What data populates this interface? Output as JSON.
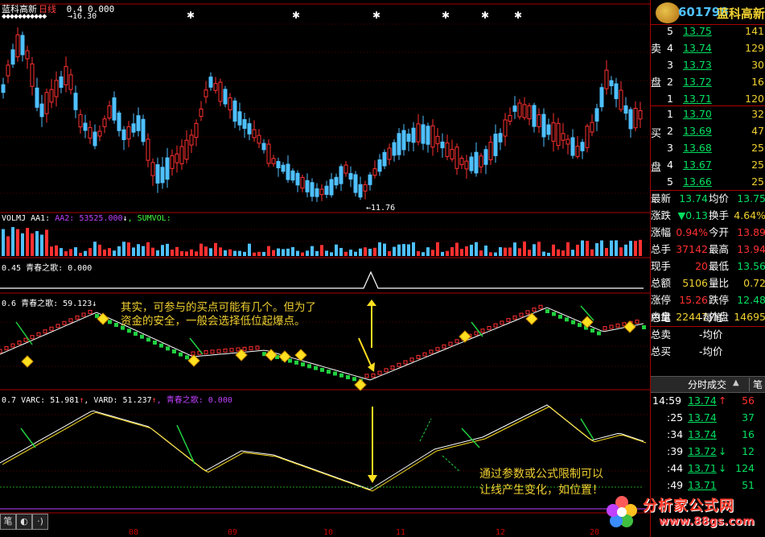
{
  "header": {
    "stock": "蓝科高新",
    "period": "日线",
    "params": "0.4  0.000",
    "high_label": "16.30",
    "low_label": "←11.76"
  },
  "indicators": {
    "vol_label": "VOLMJ  AA1:",
    "vol_aa2": "AA2: 53525.000",
    "vol_arrow": "↓",
    "vol_sumvol": ", SUMVOL:",
    "qc1_label": "0.45 青春之歌: 0.000",
    "qc2_label": "0.6 青春之歌: 59.123",
    "qc2_arrow": "↓",
    "varc_label": "0.7 VARC: 51.981",
    "varc_arrow": "↑",
    "vard_label": ", VARD: 51.237",
    "vard_arrow": "↑",
    "qc3_label": ", 青春之歌: 0.000"
  },
  "annotations": {
    "top_line1": "其实，可参与的买点可能有几个。但为了",
    "top_line2": "资金的安全，一般会选择低位起爆点。",
    "bottom_line1": "通过参数或公式限制可以",
    "bottom_line2": "让线产生变化，如位置！"
  },
  "quote": {
    "code": "601798",
    "name": "蓝科高新",
    "sell_label_1": "卖",
    "sell_label_2": "盘",
    "buy_label_1": "买",
    "buy_label_2": "盘",
    "asks": [
      {
        "level": "5",
        "price": "13.75",
        "vol": "141"
      },
      {
        "level": "4",
        "price": "13.74",
        "vol": "129"
      },
      {
        "level": "3",
        "price": "13.73",
        "vol": "30"
      },
      {
        "level": "2",
        "price": "13.72",
        "vol": "16"
      },
      {
        "level": "1",
        "price": "13.71",
        "vol": "120"
      }
    ],
    "bids": [
      {
        "level": "1",
        "price": "13.70",
        "vol": "32"
      },
      {
        "level": "2",
        "price": "13.69",
        "vol": "47"
      },
      {
        "level": "3",
        "price": "13.68",
        "vol": "25"
      },
      {
        "level": "4",
        "price": "13.67",
        "vol": "25"
      },
      {
        "level": "5",
        "price": "13.66",
        "vol": "25"
      }
    ],
    "stats": [
      {
        "l1": "最新",
        "v1": "13.74",
        "l2": "均价",
        "v2": "13.75"
      },
      {
        "l1": "涨跌",
        "v1": "▼0.13",
        "l2": "换手",
        "v2": "4.64%"
      },
      {
        "l1": "涨幅",
        "v1": "0.94%",
        "l2": "今开",
        "v2": "13.89"
      },
      {
        "l1": "总手",
        "v1": "37142",
        "l2": "最高",
        "v2": "13.94"
      },
      {
        "l1": "现手",
        "v1": "20",
        "l2": "最低",
        "v2": "13.56"
      },
      {
        "l1": "总额",
        "v1": "5106",
        "l2": "量比",
        "v2": "0.72"
      },
      {
        "l1": "涨停",
        "v1": "15.26",
        "l2": "跌停",
        "v2": "12.48"
      },
      {
        "l1": "内盘",
        "v1": "22447",
        "l2": "外盘",
        "v2": "14695"
      }
    ],
    "extra": [
      {
        "l": "总笔",
        "v": "-每笔",
        "r": "-"
      },
      {
        "l": "总卖",
        "v": "-均价",
        "r": "-"
      },
      {
        "l": "总买",
        "v": "-均价",
        "r": "-"
      }
    ],
    "tab_label": "分时成交",
    "tab_arrow": "▲",
    "tab_num": "笔",
    "ticks": [
      {
        "t": "14:59",
        "p": "13.74",
        "d": "↑",
        "v": "56"
      },
      {
        "t": ":25",
        "p": "13.74",
        "d": "",
        "v": "37"
      },
      {
        "t": ":34",
        "p": "13.74",
        "d": "",
        "v": "16"
      },
      {
        "t": ":39",
        "p": "13.72",
        "d": "↓",
        "v": "12"
      },
      {
        "t": ":44",
        "p": "13.71",
        "d": "↓",
        "v": "124"
      },
      {
        "t": ":49",
        "p": "13.71",
        "d": "",
        "v": "51"
      }
    ]
  },
  "bottom": {
    "btn1": "笔",
    "btn2": "◐",
    "btn3": "·)",
    "months": [
      "08",
      "09",
      "10",
      "11",
      "12",
      "20"
    ]
  },
  "watermark": {
    "text": "分析家公式网",
    "url": "www.88gs.com"
  },
  "colors": {
    "up": "#ff3030",
    "down": "#4ec0ff",
    "grid": "#8b0000",
    "text_yellow": "#f0d030"
  }
}
